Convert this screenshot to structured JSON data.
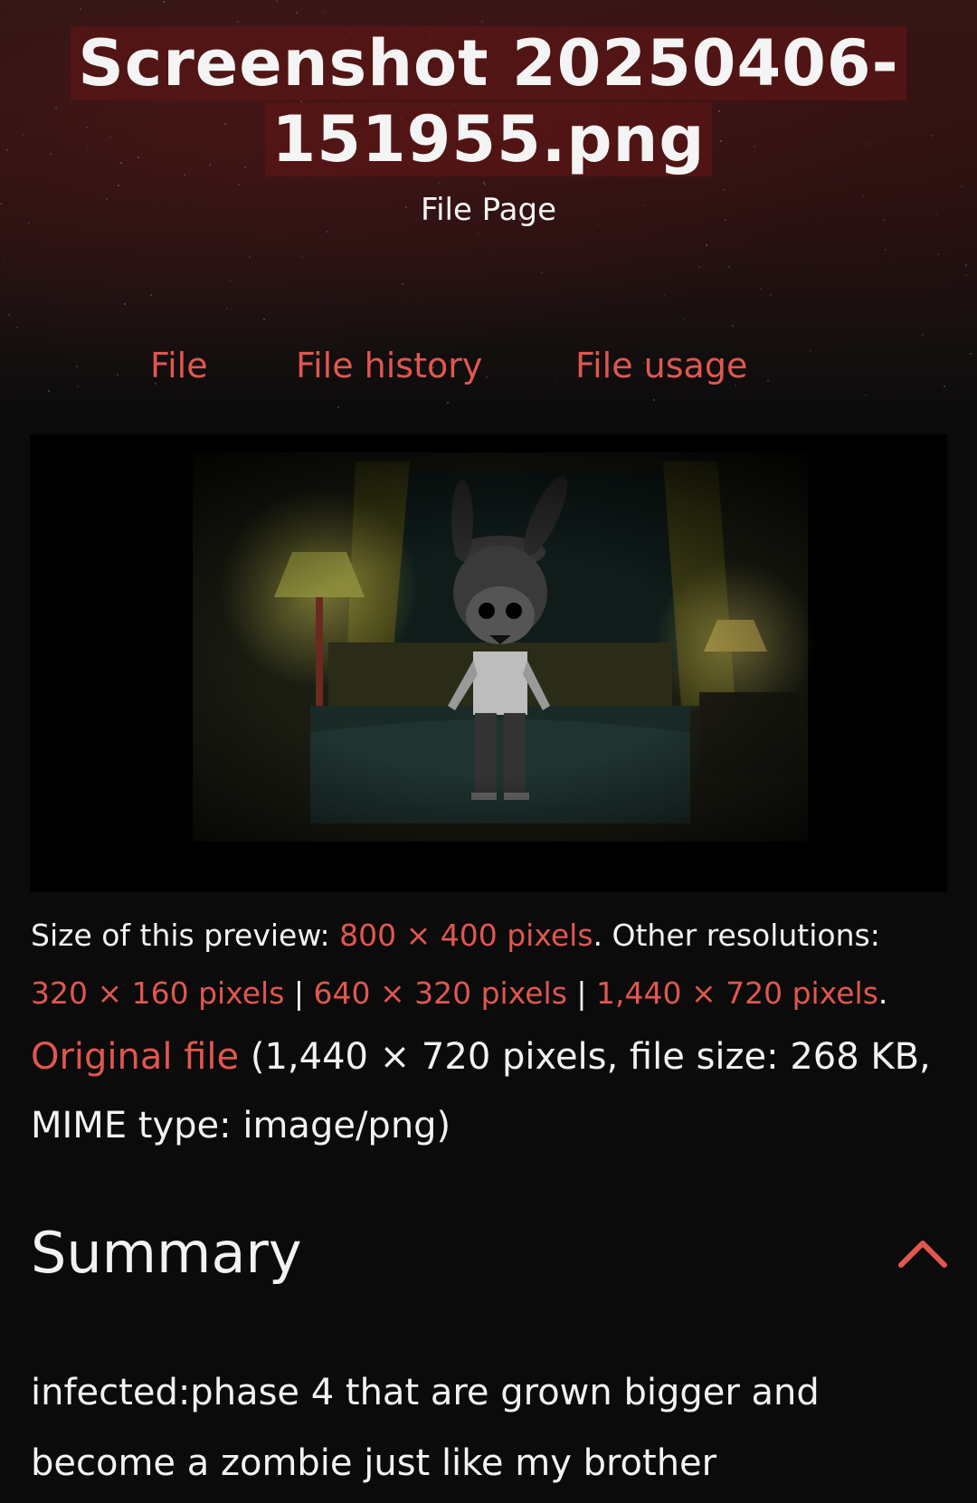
{
  "header": {
    "title_line1": "Screenshot 20250406-",
    "title_line2": "151955.png",
    "subtitle": "File Page"
  },
  "tabs": [
    {
      "label": "File"
    },
    {
      "label": "File history"
    },
    {
      "label": "File usage"
    }
  ],
  "preview": {
    "size_label": "Size of this preview:",
    "size_value": "800 × 400 pixels",
    "other_label": ". Other resolutions:",
    "resolutions": [
      "320 × 160 pixels",
      "640 × 320 pixels",
      "1,440 × 720 pixels"
    ],
    "separator": "|",
    "end_period": "."
  },
  "original": {
    "link_label": "Original file",
    "details": " (1,440 × 720 pixels, file size: 268 KB, MIME type: image/png)"
  },
  "summary": {
    "heading": "Summary",
    "text": "infected:phase 4 that are grown bigger and become a zombie just like my brother"
  },
  "colors": {
    "accent": "#e0574f",
    "background": "#0b0b0b",
    "header_bg": "#2a1414",
    "text": "#f2f2f2"
  },
  "icons": {
    "collapse": "chevron-up-icon"
  }
}
